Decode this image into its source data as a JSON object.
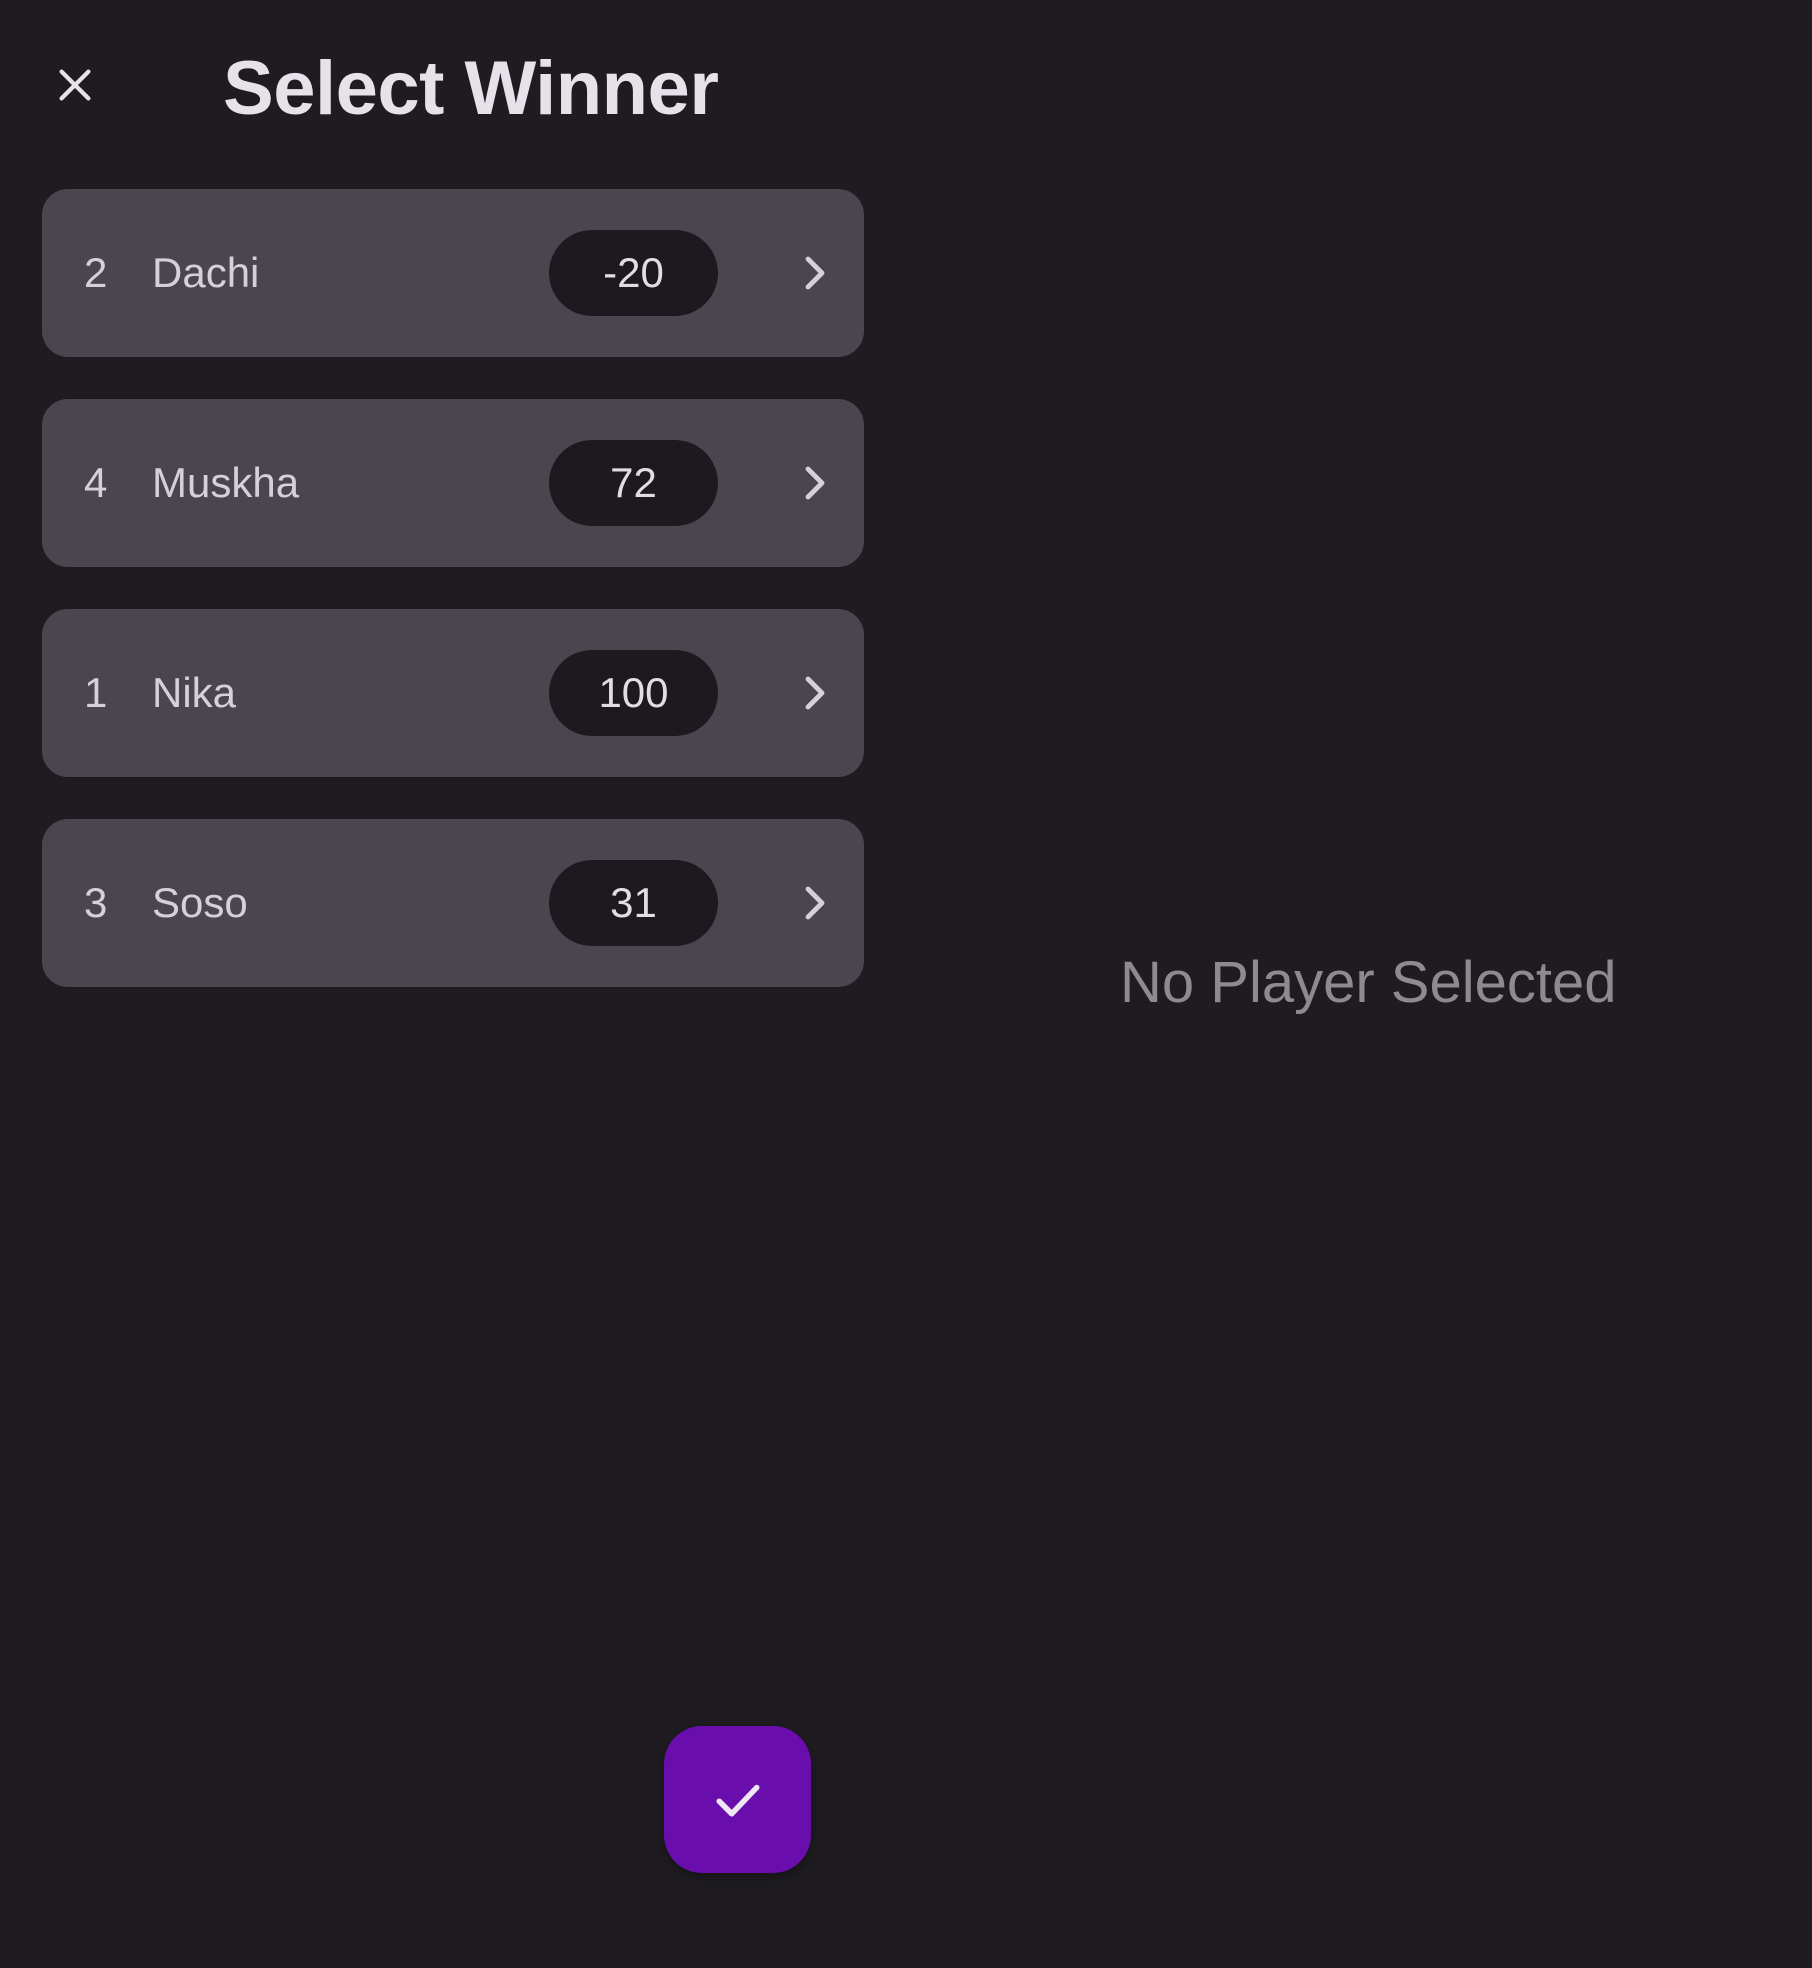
{
  "header": {
    "title": "Select Winner",
    "close_icon": "close-icon"
  },
  "players": [
    {
      "rank": "2",
      "name": "Dachi",
      "score": "-20"
    },
    {
      "rank": "4",
      "name": "Muskha",
      "score": "72"
    },
    {
      "rank": "1",
      "name": "Nika",
      "score": "100"
    },
    {
      "rank": "3",
      "name": "Soso",
      "score": "31"
    }
  ],
  "detail": {
    "empty_text": "No Player Selected"
  },
  "fab": {
    "icon": "check-icon",
    "color": "#6a0dad"
  },
  "colors": {
    "background": "#1e1c20",
    "card": "#4a464f",
    "score_pill": "#1c1a1e"
  }
}
